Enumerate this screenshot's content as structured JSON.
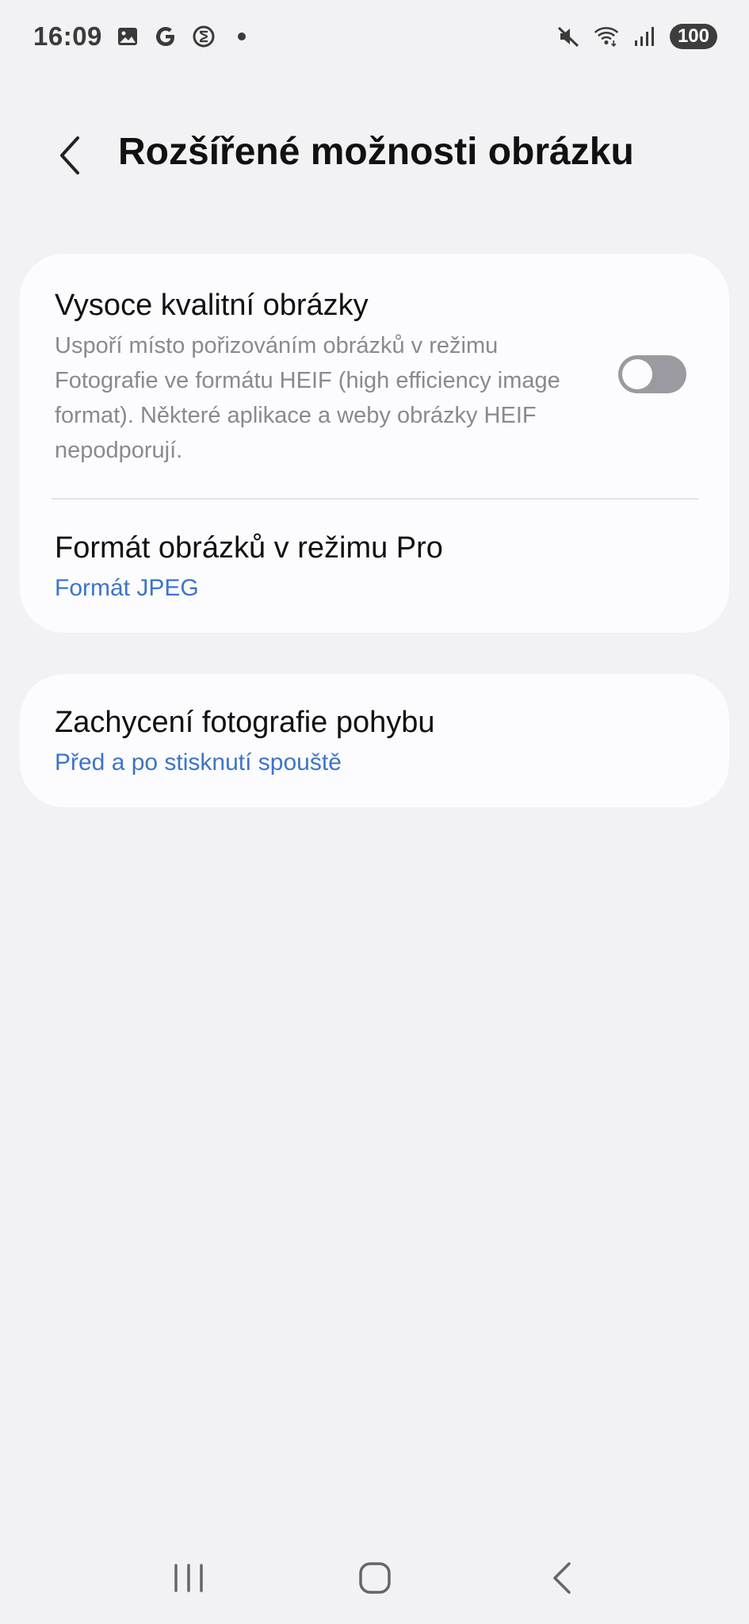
{
  "status_bar": {
    "time": "16:09",
    "battery": "100",
    "left_icons": [
      "gallery-icon",
      "google-icon",
      "digital-wellbeing-icon",
      "dot-icon"
    ],
    "right_icons": [
      "mute-icon",
      "wifi-icon",
      "signal-icon"
    ]
  },
  "header": {
    "title": "Rozšířené možnosti obrázku"
  },
  "settings": [
    {
      "title": "Vysoce kvalitní obrázky",
      "description": "Uspoří místo pořizováním obrázků v režimu Fotografie ve formátu HEIF (high efficiency image format). Některé aplikace a weby obrázky HEIF nepodporují.",
      "toggle_on": false
    },
    {
      "title": "Formát obrázků v režimu Pro",
      "value": "Formát JPEG"
    },
    {
      "title": "Zachycení fotografie pohybu",
      "value": "Před a po stisknutí spouště"
    }
  ],
  "colors": {
    "accent": "#3e74c9",
    "background": "#f2f2f4",
    "card": "#fcfcfe",
    "toggle_off": "#9a9aa0"
  },
  "navbar": [
    "recents-icon",
    "home-icon",
    "back-icon"
  ]
}
